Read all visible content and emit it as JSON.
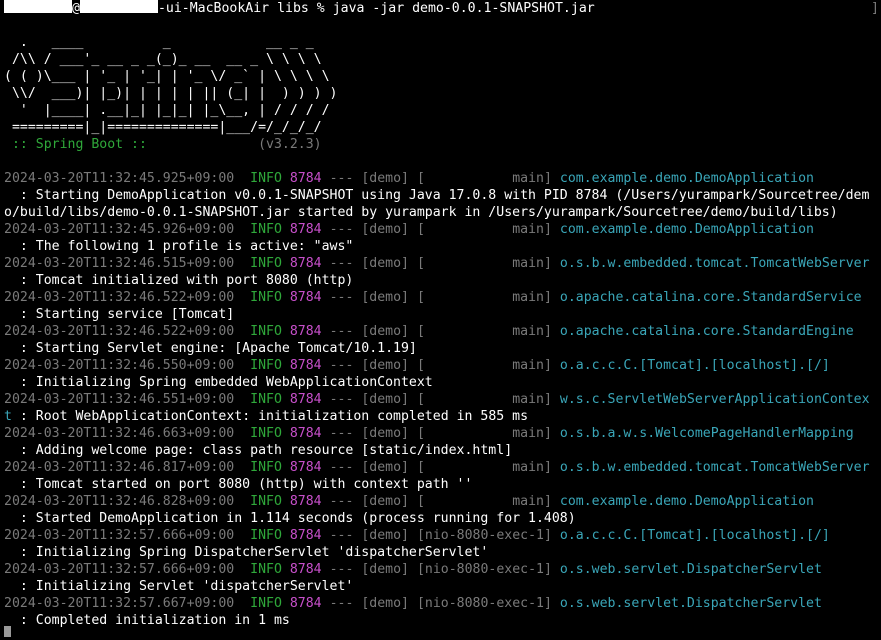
{
  "prompt": {
    "host_suffix": "-ui-MacBookAir",
    "at": "@",
    "cwd": "libs",
    "symbol": "%",
    "command": "java -jar demo-0.0.1-SNAPSHOT.jar",
    "right_bracket": "]"
  },
  "banner": [
    "  .   ____          _            __ _ _",
    " /\\\\ / ___'_ __ _ _(_)_ __  __ _ \\ \\ \\ \\",
    "( ( )\\___ | '_ | '_| | '_ \\/ _` | \\ \\ \\ \\",
    " \\\\/  ___)| |_)| | | | | || (_| |  ) ) ) )",
    "  '  |____| .__|_| |_|_| |_\\__, | / / / /",
    " =========|_|==============|___/=/_/_/_/"
  ],
  "spring_boot": {
    "label": " :: Spring Boot :: ",
    "pad": "             ",
    "version": "(v3.2.3)"
  },
  "logs": [
    {
      "ts": "2024-03-20T11:32:45.925+09:00",
      "level": "INFO",
      "pid": "8784",
      "sep": "---",
      "app": "[demo]",
      "thread": "[           main]",
      "logger": "com.example.demo.DemoApplication",
      "message": "  : Starting DemoApplication v0.0.1-SNAPSHOT using Java 17.0.8 with PID 8784 (/Users/yurampark/Sourcetree/dem",
      "message2": "o/build/libs/demo-0.0.1-SNAPSHOT.jar started by yurampark in /Users/yurampark/Sourcetree/demo/build/libs)"
    },
    {
      "ts": "2024-03-20T11:32:45.926+09:00",
      "level": "INFO",
      "pid": "8784",
      "sep": "---",
      "app": "[demo]",
      "thread": "[           main]",
      "logger": "com.example.demo.DemoApplication",
      "message": "  : The following 1 profile is active: \"aws\""
    },
    {
      "ts": "2024-03-20T11:32:46.515+09:00",
      "level": "INFO",
      "pid": "8784",
      "sep": "---",
      "app": "[demo]",
      "thread": "[           main]",
      "logger": "o.s.b.w.embedded.tomcat.TomcatWebServer",
      "message": "  : Tomcat initialized with port 8080 (http)"
    },
    {
      "ts": "2024-03-20T11:32:46.522+09:00",
      "level": "INFO",
      "pid": "8784",
      "sep": "---",
      "app": "[demo]",
      "thread": "[           main]",
      "logger": "o.apache.catalina.core.StandardService",
      "message": "  : Starting service [Tomcat]"
    },
    {
      "ts": "2024-03-20T11:32:46.522+09:00",
      "level": "INFO",
      "pid": "8784",
      "sep": "---",
      "app": "[demo]",
      "thread": "[           main]",
      "logger": "o.apache.catalina.core.StandardEngine",
      "message": "  : Starting Servlet engine: [Apache Tomcat/10.1.19]"
    },
    {
      "ts": "2024-03-20T11:32:46.550+09:00",
      "level": "INFO",
      "pid": "8784",
      "sep": "---",
      "app": "[demo]",
      "thread": "[           main]",
      "logger": "o.a.c.c.C.[Tomcat].[localhost].[/]",
      "message": "  : Initializing Spring embedded WebApplicationContext"
    },
    {
      "ts": "2024-03-20T11:32:46.551+09:00",
      "level": "INFO",
      "pid": "8784",
      "sep": "---",
      "app": "[demo]",
      "thread": "[           main]",
      "logger": "w.s.c.ServletWebServerApplicationContex",
      "logger_cont": "t",
      "message": " : Root WebApplicationContext: initialization completed in 585 ms"
    },
    {
      "ts": "2024-03-20T11:32:46.663+09:00",
      "level": "INFO",
      "pid": "8784",
      "sep": "---",
      "app": "[demo]",
      "thread": "[           main]",
      "logger": "o.s.b.a.w.s.WelcomePageHandlerMapping",
      "message": "  : Adding welcome page: class path resource [static/index.html]"
    },
    {
      "ts": "2024-03-20T11:32:46.817+09:00",
      "level": "INFO",
      "pid": "8784",
      "sep": "---",
      "app": "[demo]",
      "thread": "[           main]",
      "logger": "o.s.b.w.embedded.tomcat.TomcatWebServer",
      "message": "  : Tomcat started on port 8080 (http) with context path ''"
    },
    {
      "ts": "2024-03-20T11:32:46.828+09:00",
      "level": "INFO",
      "pid": "8784",
      "sep": "---",
      "app": "[demo]",
      "thread": "[           main]",
      "logger": "com.example.demo.DemoApplication",
      "message": "  : Started DemoApplication in 1.114 seconds (process running for 1.408)"
    },
    {
      "ts": "2024-03-20T11:32:57.666+09:00",
      "level": "INFO",
      "pid": "8784",
      "sep": "---",
      "app": "[demo]",
      "thread": "[nio-8080-exec-1]",
      "logger": "o.a.c.c.C.[Tomcat].[localhost].[/]",
      "message": "  : Initializing Spring DispatcherServlet 'dispatcherServlet'"
    },
    {
      "ts": "2024-03-20T11:32:57.666+09:00",
      "level": "INFO",
      "pid": "8784",
      "sep": "---",
      "app": "[demo]",
      "thread": "[nio-8080-exec-1]",
      "logger": "o.s.web.servlet.DispatcherServlet",
      "message": "  : Initializing Servlet 'dispatcherServlet'"
    },
    {
      "ts": "2024-03-20T11:32:57.667+09:00",
      "level": "INFO",
      "pid": "8784",
      "sep": "---",
      "app": "[demo]",
      "thread": "[nio-8080-exec-1]",
      "logger": "o.s.web.servlet.DispatcherServlet",
      "message": "  : Completed initialization in 1 ms"
    }
  ],
  "colors": {
    "background": "#000000",
    "text": "#ffffff",
    "timestamp": "#7a7a7a",
    "level_info": "#2fa83a",
    "pid": "#c64fc9",
    "logger": "#3aa6b8",
    "spring_boot_label": "#2fa83a"
  }
}
